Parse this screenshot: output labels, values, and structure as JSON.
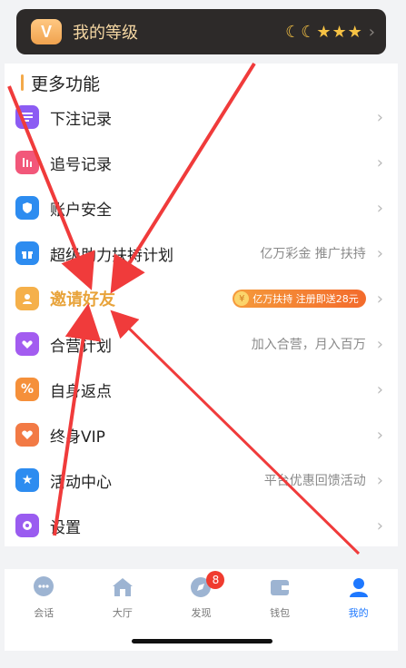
{
  "level": {
    "title": "我的等级",
    "icon_letter": "V",
    "badges": "☾☾★★★",
    "chevron": "›"
  },
  "section": {
    "title": "更多功能"
  },
  "menu": [
    {
      "label": "下注记录",
      "sub": "",
      "icon": "list-icon",
      "color": "#8c5cf3"
    },
    {
      "label": "追号记录",
      "sub": "",
      "icon": "bars-icon",
      "color": "#f2577a"
    },
    {
      "label": "账户安全",
      "sub": "",
      "icon": "shield-icon",
      "color": "#2d8cf0"
    },
    {
      "label": "超级助力扶持计划",
      "sub": "亿万彩金 推广扶持",
      "icon": "gift-icon",
      "color": "#2d8cf0"
    },
    {
      "label": "邀请好友",
      "sub": "",
      "icon": "person-icon",
      "color": "#f5b04a"
    },
    {
      "label": "合营计划",
      "sub": "加入合营，月入百万",
      "icon": "handshake-icon",
      "color": "#a35cf0"
    },
    {
      "label": "自身返点",
      "sub": "",
      "icon": "percent-icon",
      "color": "#f5903a"
    },
    {
      "label": "终身VIP",
      "sub": "",
      "icon": "heart-icon",
      "color": "#f27a45"
    },
    {
      "label": "活动中心",
      "sub": "平台优惠回馈活动",
      "icon": "star-icon",
      "color": "#2d8cf0"
    },
    {
      "label": "设置",
      "sub": "",
      "icon": "gear-icon",
      "color": "#9a5cf0"
    }
  ],
  "promo": {
    "text": "亿万扶持 注册即送28元"
  },
  "tabs": [
    {
      "label": "会话",
      "icon": "chat-icon"
    },
    {
      "label": "大厅",
      "icon": "home-icon"
    },
    {
      "label": "发现",
      "icon": "compass-icon",
      "badge": "8"
    },
    {
      "label": "钱包",
      "icon": "wallet-icon"
    },
    {
      "label": "我的",
      "icon": "user-icon"
    }
  ],
  "colors": {
    "accent": "#1e78ff",
    "gold": "#e8a33a",
    "annotation": "#f03b3b"
  }
}
